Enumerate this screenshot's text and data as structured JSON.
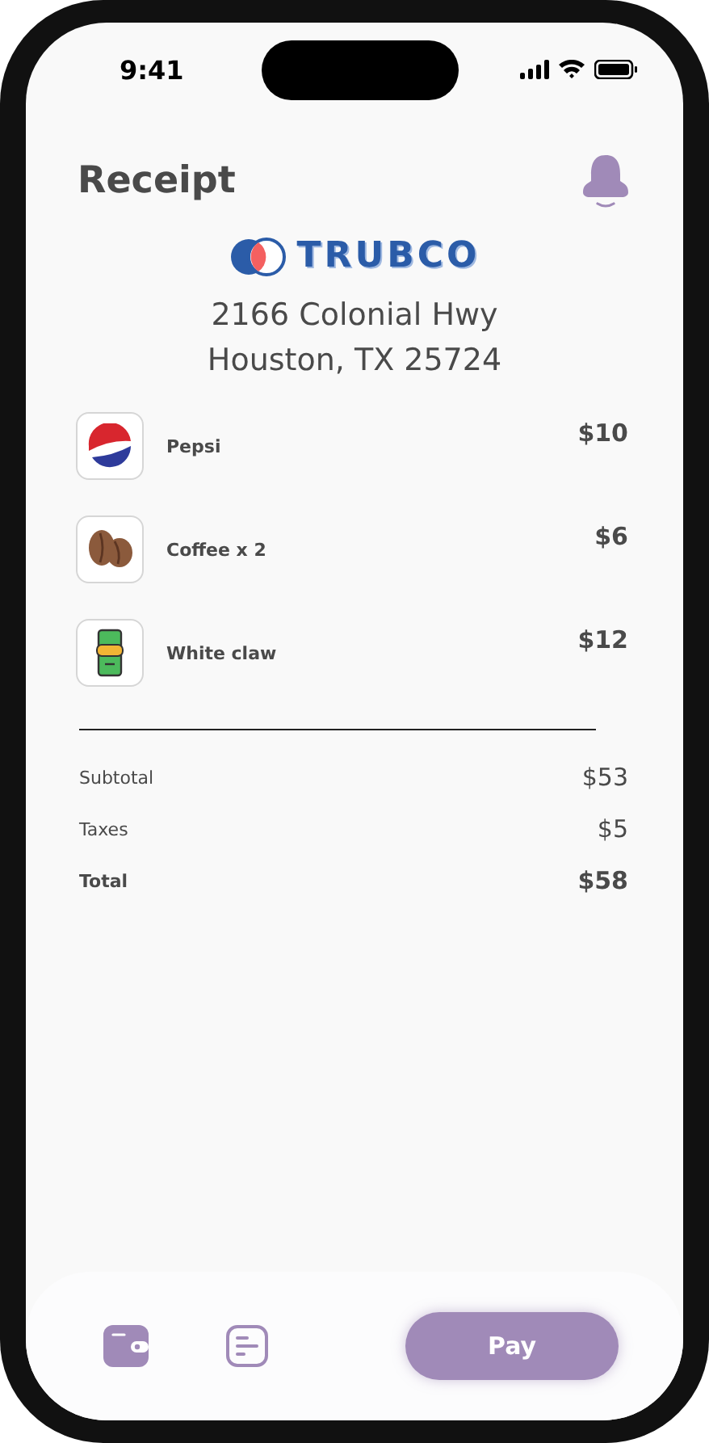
{
  "status_bar": {
    "time": "9:41"
  },
  "header": {
    "title": "Receipt"
  },
  "store": {
    "brand": "TRUBCO",
    "address_lines": [
      "2166 Colonial Hwy",
      "Houston, TX 25724"
    ]
  },
  "items": [
    {
      "kind": "soda",
      "name": "Pepsi",
      "price": "$10"
    },
    {
      "kind": "coffee",
      "name": "Coffee x 2",
      "price": "$6"
    },
    {
      "kind": "can",
      "name": "White claw",
      "price": "$12"
    }
  ],
  "summary": [
    {
      "label": "Subtotal",
      "value": "$53",
      "bold": false
    },
    {
      "label": "Taxes",
      "value": "$5",
      "bold": false
    },
    {
      "label": "Total",
      "value": "$58",
      "bold": true
    }
  ],
  "tab_bar": {
    "items": [
      {
        "kind": "wallet"
      },
      {
        "kind": "receipt"
      }
    ],
    "action": "Pay"
  }
}
